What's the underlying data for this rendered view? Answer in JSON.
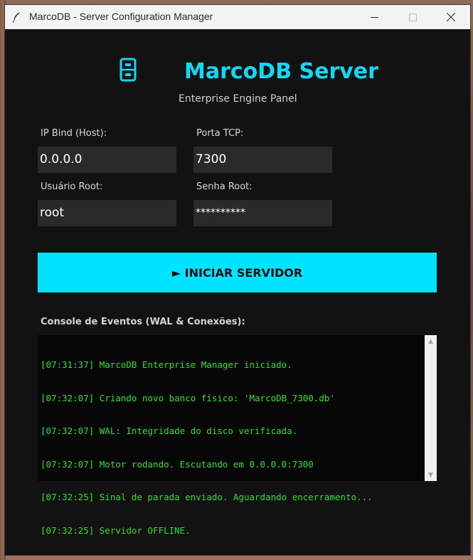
{
  "window": {
    "title": "MarcoDB - Server Configuration Manager"
  },
  "header": {
    "title": "MarcoDB Server",
    "subtitle": "Enterprise Engine Panel"
  },
  "form": {
    "ip_label": "IP Bind (Host):",
    "ip_value": "0.0.0.0",
    "port_label": "Porta TCP:",
    "port_value": "7300",
    "user_label": "Usuário Root:",
    "user_value": "root",
    "pass_label": "Senha Root:",
    "pass_value": "**********"
  },
  "start_button": {
    "label": "► INICIAR SERVIDOR"
  },
  "console": {
    "label": "Console de Eventos (WAL & Conexões):",
    "lines": [
      "[07:31:37] MarcoDB Enterprise Manager iniciado.",
      "[07:32:07] Criando novo banco físico: 'MarcoDB_7300.db'",
      "[07:32:07] WAL: Integridade do disco verificada.",
      "[07:32:07] Motor rodando. Escutando em 0.0.0.0:7300",
      "[07:32:25] Sinal de parada enviado. Aguardando encerramento...",
      "[07:32:25] Servidor OFFLINE."
    ]
  },
  "colors": {
    "accent": "#12d8f3",
    "button": "#00e3ff",
    "console_text": "#2ee02e",
    "background": "#121212"
  },
  "icons": {
    "app": "feather-icon",
    "logo": "file-cabinet-icon",
    "minimize": "minimize-icon",
    "maximize": "maximize-icon",
    "close": "close-icon"
  }
}
